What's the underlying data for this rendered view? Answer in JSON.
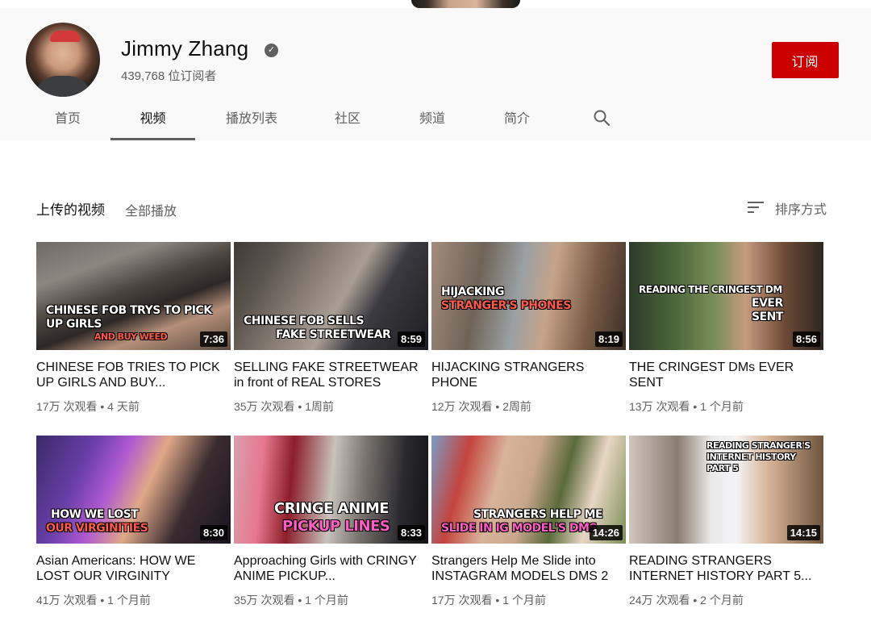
{
  "channel": {
    "name": "Jimmy Zhang",
    "subscribers": "439,768 位订阅者",
    "subscribe_label": "订阅",
    "verified_glyph": "✓"
  },
  "tabs": [
    {
      "label": "首页",
      "active": false
    },
    {
      "label": "视频",
      "active": true
    },
    {
      "label": "播放列表",
      "active": false
    },
    {
      "label": "社区",
      "active": false
    },
    {
      "label": "频道",
      "active": false
    },
    {
      "label": "简介",
      "active": false
    }
  ],
  "section": {
    "title": "上传的视频",
    "play_all": "全部播放",
    "sort_label": "排序方式"
  },
  "videos": [
    {
      "title": "CHINESE FOB TRIES TO PICK UP GIRLS AND BUY...",
      "meta": "17万 次观看 • 4 天前",
      "duration": "7:36",
      "overlay_1": "CHINESE FOB TRYS TO PICK UP GIRLS",
      "overlay_2": "AND BUY WEED"
    },
    {
      "title": "SELLING FAKE STREETWEAR in front of REAL STORES",
      "meta": "35万 次观看 • 1周前",
      "duration": "8:59",
      "overlay_1": "CHINESE FOB SELLS",
      "overlay_2": "FAKE STREETWEAR"
    },
    {
      "title": "HIJACKING STRANGERS PHONE",
      "meta": "12万 次观看 • 2周前",
      "duration": "8:19",
      "overlay_1": "HIJACKING",
      "overlay_2": "STRANGER'S PHONES"
    },
    {
      "title": "THE CRINGEST DMs EVER SENT",
      "meta": "13万 次观看 • 1 个月前",
      "duration": "8:56",
      "overlay_1": "READING THE CRINGEST DM",
      "overlay_2": "EVER SENT"
    },
    {
      "title": "Asian Americans: HOW WE LOST OUR VIRGINITY",
      "meta": "41万 次观看 • 1 个月前",
      "duration": "8:30",
      "overlay_1": "HOW WE LOST",
      "overlay_2": "OUR VIRGINITIES"
    },
    {
      "title": "Approaching Girls with CRINGY ANIME PICKUP...",
      "meta": "35万 次观看 • 1 个月前",
      "duration": "8:33",
      "overlay_1": "CRINGE ANIME",
      "overlay_2": "PICKUP LINES"
    },
    {
      "title": "Strangers Help Me Slide into INSTAGRAM MODELS DMS 2",
      "meta": "17万 次观看 • 1 个月前",
      "duration": "14:26",
      "overlay_1": "STRANGERS HELP ME",
      "overlay_2": "SLIDE IN IG MODEL'S DMS"
    },
    {
      "title": "READING STRANGERS INTERNET HISTORY PART 5...",
      "meta": "24万 次观看 • 2 个月前",
      "duration": "14:15",
      "overlay_1": "READING STRANGER'S",
      "overlay_2": "INTERNET HISTORY PART 5"
    }
  ],
  "colors": {
    "subscribe_red": "#cc0000",
    "header_bg": "#f9f9f9",
    "secondary_text": "#606060"
  },
  "icons": {
    "search": "search-icon",
    "sort": "sort-icon",
    "verified": "verified-icon"
  }
}
